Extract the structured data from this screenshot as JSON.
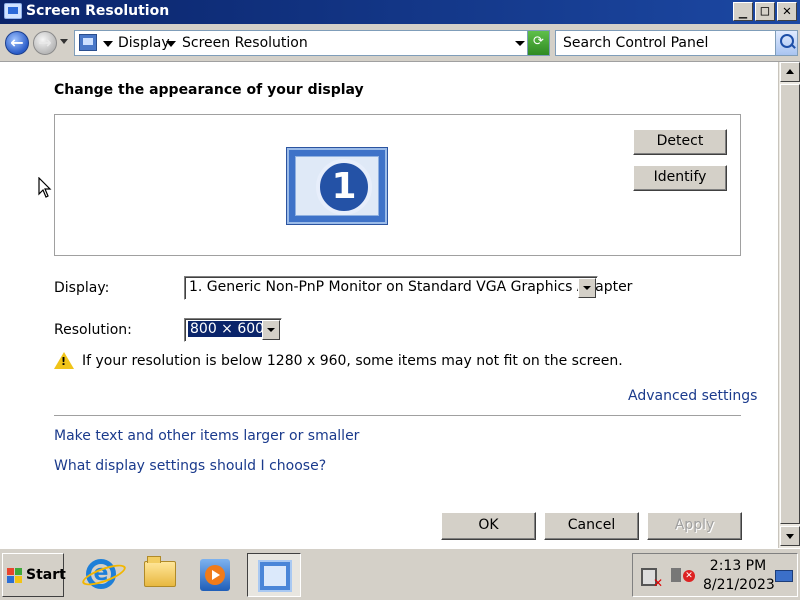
{
  "window": {
    "title": "Screen Resolution",
    "controls": {
      "minimize": "_",
      "maximize": "□",
      "close": "✕"
    }
  },
  "address": {
    "breadcrumbs": [
      "Display",
      "Screen Resolution"
    ],
    "search_placeholder": "Search Control Panel"
  },
  "main": {
    "heading": "Change the appearance of your display",
    "monitor_number": "1",
    "detect_label": "Detect",
    "identify_label": "Identify",
    "display_label": "Display:",
    "display_value": "1. Generic Non-PnP Monitor on Standard VGA Graphics Adapter",
    "resolution_label": "Resolution:",
    "resolution_value": "800 × 600",
    "warning_text": "If your resolution is below 1280 x 960, some items may not fit on the screen.",
    "advanced_link": "Advanced settings",
    "link_text_size": "Make text and other items larger or smaller",
    "link_which_settings": "What display settings should I choose?"
  },
  "footer": {
    "ok_label": "OK",
    "cancel_label": "Cancel",
    "apply_label": "Apply"
  },
  "taskbar": {
    "start_label": "Start",
    "pinned": [
      "internet-explorer-icon",
      "folder-icon",
      "media-player-icon",
      "display-settings-icon"
    ],
    "clock_time": "2:13 PM",
    "clock_date": "8/21/2023"
  }
}
